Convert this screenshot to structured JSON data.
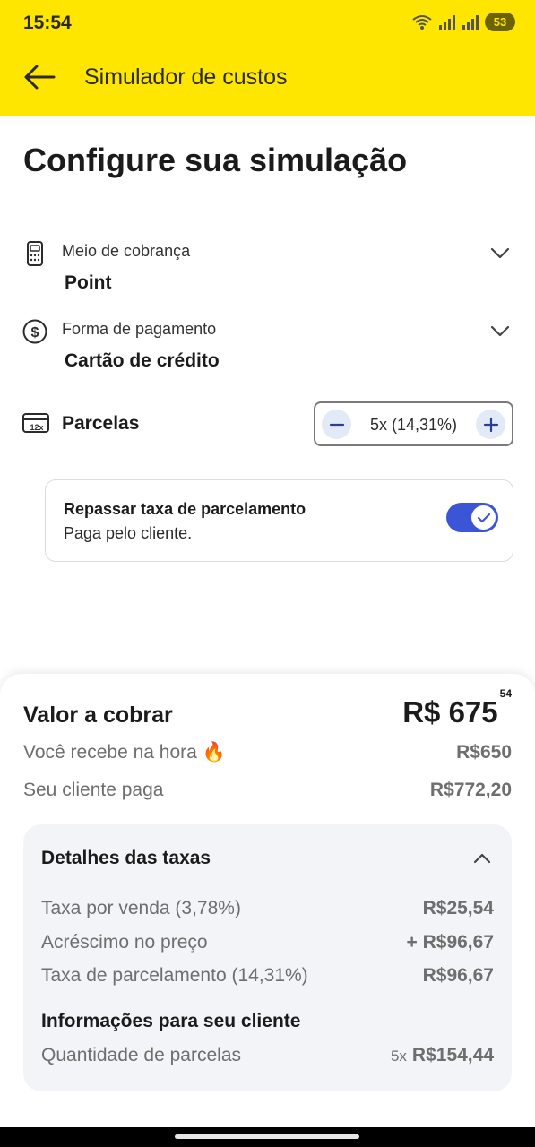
{
  "status_bar": {
    "time": "15:54",
    "battery": "53"
  },
  "header": {
    "title": "Simulador de custos"
  },
  "page": {
    "title": "Configure sua simulação"
  },
  "billing_method": {
    "label": "Meio de cobrança",
    "value": "Point"
  },
  "payment_method": {
    "label": "Forma de pagamento",
    "value": "Cartão de crédito"
  },
  "installments": {
    "label": "Parcelas",
    "value": "5x (14,31%)"
  },
  "pass_fee": {
    "title": "Repassar taxa de parcelamento",
    "subtitle": "Paga pelo cliente.",
    "enabled": true
  },
  "summary": {
    "amount_label": "Valor a cobrar",
    "amount_currency": "R$",
    "amount_main": "675",
    "amount_cents": "54",
    "receive_label": "Você recebe na hora 🔥",
    "receive_value": "R$650",
    "client_pays_label": "Seu cliente paga",
    "client_pays_value": "R$772,20"
  },
  "details": {
    "title": "Detalhes das taxas",
    "rows": [
      {
        "label": "Taxa por venda (3,78%)",
        "value": "R$25,54"
      },
      {
        "label": "Acréscimo no preço",
        "value": "+ R$96,67"
      },
      {
        "label": "Taxa de parcelamento (14,31%)",
        "value": "R$96,67"
      }
    ],
    "info_title": "Informações para seu cliente",
    "installments_label": "Quantidade de parcelas",
    "installments_count": "5x",
    "installments_value": "R$154,44"
  },
  "colors": {
    "header": "#ffe600",
    "toggle": "#3a55d6",
    "card": "#f3f4f8"
  }
}
